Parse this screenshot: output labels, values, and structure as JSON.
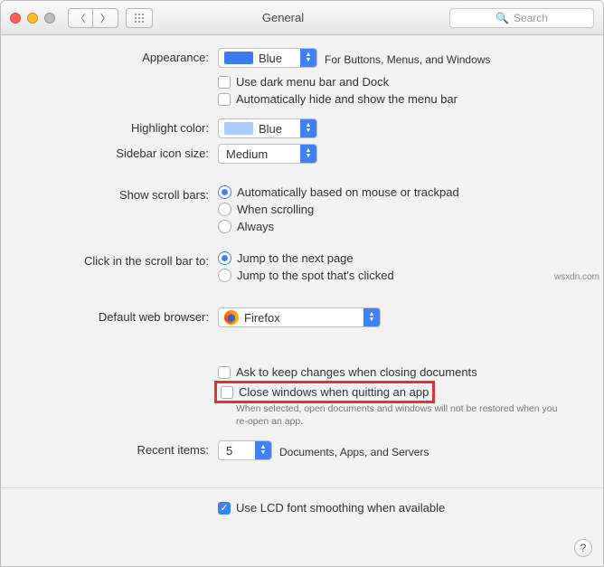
{
  "titlebar": {
    "title": "General",
    "search_placeholder": "Search"
  },
  "appearance": {
    "label": "Appearance:",
    "value": "Blue",
    "swatch": "#3a7af2",
    "hint": "For Buttons, Menus, and Windows",
    "dark_menu": "Use dark menu bar and Dock",
    "auto_hide": "Automatically hide and show the menu bar"
  },
  "highlight": {
    "label": "Highlight color:",
    "value": "Blue",
    "swatch": "#a9cefb"
  },
  "sidebar": {
    "label": "Sidebar icon size:",
    "value": "Medium"
  },
  "scrollbars": {
    "label": "Show scroll bars:",
    "opt1": "Automatically based on mouse or trackpad",
    "opt2": "When scrolling",
    "opt3": "Always"
  },
  "clickscroll": {
    "label": "Click in the scroll bar to:",
    "opt1": "Jump to the next page",
    "opt2": "Jump to the spot that's clicked"
  },
  "browser": {
    "label": "Default web browser:",
    "value": "Firefox"
  },
  "ask_changes": "Ask to keep changes when closing documents",
  "close_windows": "Close windows when quitting an app",
  "close_help": "When selected, open documents and windows will not be restored when you re-open an app.",
  "recent": {
    "label": "Recent items:",
    "value": "5",
    "suffix": "Documents, Apps, and Servers"
  },
  "lcd": "Use LCD font smoothing when available",
  "watermark": "wsxdn.com"
}
